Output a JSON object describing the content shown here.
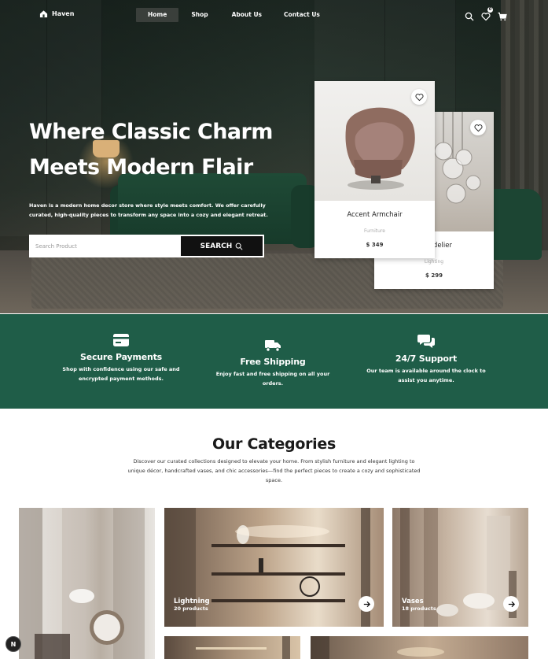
{
  "nav": {
    "brand": "Haven",
    "links": [
      "Home",
      "Shop",
      "About Us",
      "Contact Us"
    ],
    "active": "Home",
    "wishlist_count": "0"
  },
  "hero": {
    "title_line1": "Where Classic Charm",
    "title_line2": "Meets Modern Flair",
    "description": "Haven is a modern home decor store where style meets comfort. We offer carefully curated, high-quality pieces to transform any space into a cozy and elegant retreat.",
    "search_placeholder": "Search Product",
    "search_button": "SEARCH"
  },
  "products": [
    {
      "name": "Accent Armchair",
      "category": "Furniture",
      "price": "$ 349"
    },
    {
      "name": "Chandelier",
      "category": "Lighting",
      "price": "$ 299"
    }
  ],
  "features": [
    {
      "icon": "credit-card-icon",
      "title": "Secure Payments",
      "text": "Shop with confidence using our safe and encrypted payment methods."
    },
    {
      "icon": "truck-icon",
      "title": "Free Shipping",
      "text": "Enjoy fast and free shipping on all your orders."
    },
    {
      "icon": "chat-bubbles-icon",
      "title": "24/7 Support",
      "text": "Our team is available around the clock to assist you anytime."
    }
  ],
  "categories": {
    "title": "Our Categories",
    "description": "Discover our curated collections designed to elevate your home. From stylish furniture and elegant lighting to unique décor, handcrafted vases, and chic accessories—find the perfect pieces to create a cozy and sophisticated space.",
    "tiles": [
      {
        "name": "Lightning",
        "count": "20 products"
      },
      {
        "name": "Vases",
        "count": "18 products"
      }
    ]
  },
  "dev_badge": "N",
  "colors": {
    "accent_green": "#1f5d48",
    "dark": "#111111"
  }
}
